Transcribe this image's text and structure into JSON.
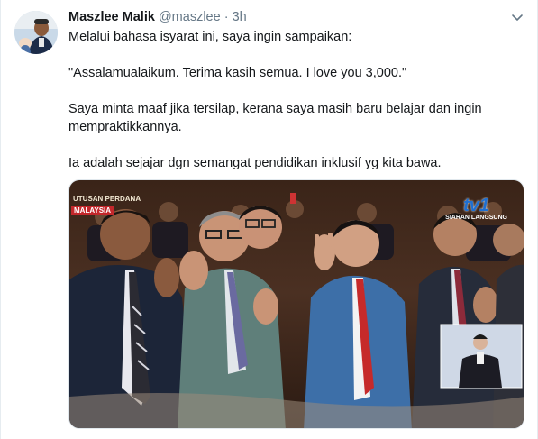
{
  "tweet": {
    "author_name": "Maszlee Malik",
    "handle": "@maszlee",
    "separator": "·",
    "time": "3h",
    "paragraphs": [
      "Melalui bahasa isyarat ini, saya ingin sampaikan:",
      "\"Assalamualaikum. Terima kasih semua. I love you 3,000.\"",
      "Saya minta maaf jika tersilap, kerana saya masih baru belajar dan ingin mempraktikkannya.",
      "Ia adalah sejajar dgn semangat pendidikan inklusif yg kita bawa."
    ]
  },
  "media": {
    "watermark_text": "UTUSAN PERDANA",
    "event_logo_text": "MALAYSIA",
    "channel_logo": "tv1",
    "channel_sub": "SIARAN LANGSUNG"
  },
  "icons": {
    "caret": "chevron-down-icon"
  },
  "colors": {
    "text": "#14171a",
    "secondary": "#657786",
    "border": "#e6ecf0"
  }
}
